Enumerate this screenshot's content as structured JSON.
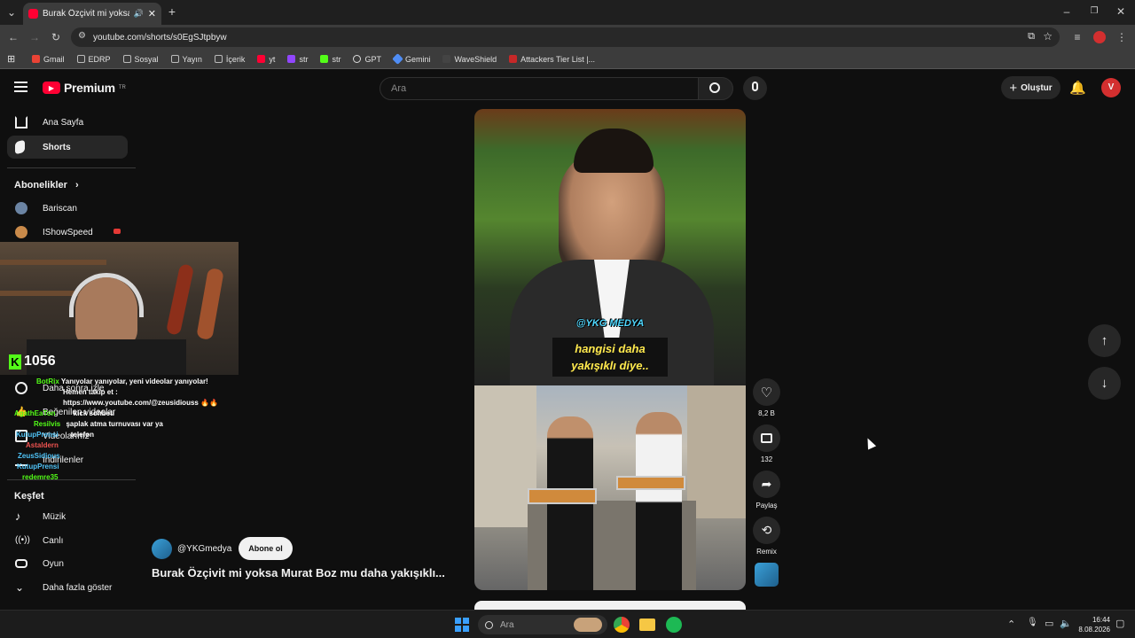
{
  "browser": {
    "tab_title": "Burak Özçivit mi yoksa Mur",
    "url": "youtube.com/shorts/s0EgSJtpbyw",
    "bookmarks": [
      {
        "label": "Gmail",
        "color": "#ea4335"
      },
      {
        "label": "EDRP",
        "color": "#9e9e9e"
      },
      {
        "label": "Sosyal",
        "color": "#9e9e9e"
      },
      {
        "label": "Yayın",
        "color": "#9e9e9e"
      },
      {
        "label": "İçerik",
        "color": "#9e9e9e"
      },
      {
        "label": "yt",
        "color": "#ff0033"
      },
      {
        "label": "str",
        "color": "#9146ff"
      },
      {
        "label": "str",
        "color": "#53fc18"
      },
      {
        "label": "GPT",
        "color": "#e0e0e0"
      },
      {
        "label": "Gemini",
        "color": "#4f8df5"
      },
      {
        "label": "WaveShield",
        "color": "#2d2d2d"
      },
      {
        "label": "Attackers Tier List |...",
        "color": "#c62828"
      }
    ]
  },
  "youtube": {
    "logo_text": "Premium",
    "logo_sup": "TR",
    "search_placeholder": "Ara",
    "create_label": "Oluştur",
    "sidebar": {
      "home": "Ana Sayfa",
      "shorts": "Shorts",
      "subscriptions_header": "Abonelikler",
      "subs": [
        "Bariscan",
        "IShowSpeed"
      ],
      "watch_later": "Daha sonra izle",
      "liked": "Beğenilen videolar",
      "your_videos": "Videolarınız",
      "downloads": "İndirilenler",
      "explore_header": "Keşfet",
      "explore": [
        "Müzik",
        "Canlı",
        "Oyun",
        "Daha fazla göster"
      ]
    },
    "short": {
      "channel": "@YKGmedya",
      "subscribe": "Abone ol",
      "title": "Burak Özçivit mi yoksa Murat Boz mu daha yakışıklı...",
      "caption_handle": "@YKG MEDYA",
      "caption_line1": "hangisi daha",
      "caption_line2": "yakışıklı diye..",
      "likes": "8,2 B",
      "comments": "132",
      "share": "Paylaş",
      "remix": "Remix"
    }
  },
  "stream_overlay": {
    "kick_viewers": "1056",
    "chat": [
      {
        "user": "BotRix",
        "text": "Yanıyolar yanıyolar, yeni videolar yanıyolar!",
        "color": "#53fc18"
      },
      {
        "user": "",
        "text": "Hemen takip et :",
        "color": "#ffffff"
      },
      {
        "user": "",
        "text": "https://www.youtube.com/@zeusidiouss 🔥🔥",
        "color": "#ffffff"
      },
      {
        "user": "AgathEaTon",
        "text": "kick sohbeti",
        "color": "#53fc18"
      },
      {
        "user": "Resilvis",
        "text": "şaplak atma turnuvası var ya",
        "color": "#53fc18"
      },
      {
        "user": "KutupPrensi",
        "text": "telefon",
        "color": "#4fc3f7"
      },
      {
        "user": "Astaldern",
        "text": "",
        "color": "#ef5350"
      },
      {
        "user": "ZeusSidious",
        "text": "",
        "color": "#4fc3f7"
      },
      {
        "user": "KutupPrensi",
        "text": "",
        "color": "#4fc3f7"
      },
      {
        "user": "redemre35",
        "text": "",
        "color": "#53fc18"
      }
    ]
  },
  "taskbar": {
    "search_placeholder": "Ara",
    "time": "16:44",
    "date": "8.08.2026"
  }
}
